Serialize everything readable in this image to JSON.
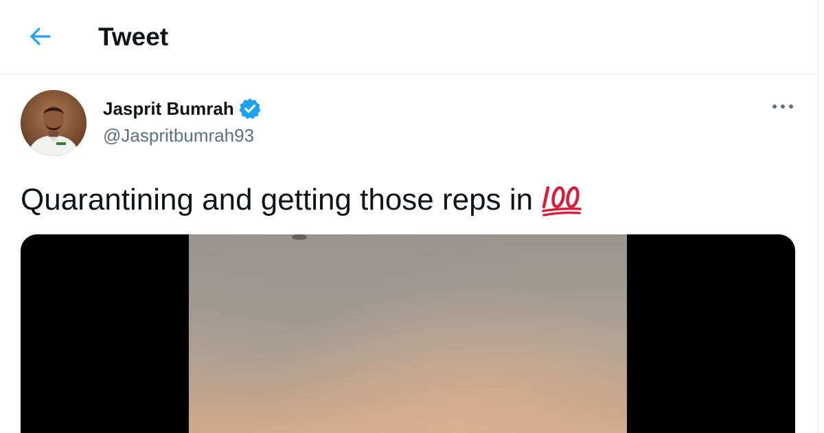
{
  "header": {
    "title": "Tweet",
    "back_icon": "arrow-left-icon"
  },
  "tweet": {
    "author": {
      "name": "Jasprit Bumrah",
      "handle": "@Jaspritbumrah93",
      "verified": true,
      "verified_icon": "verified-badge-icon"
    },
    "more_icon": "more-horizontal-icon",
    "text": "Quarantining and getting those reps in",
    "emoji_icon": "hundred-points-icon",
    "media_type": "video"
  },
  "colors": {
    "accent": "#1da1f2",
    "text_primary": "#0f1419",
    "text_secondary": "#5b7083",
    "border": "#e6ecf0",
    "emoji_red": "#d6203a"
  }
}
